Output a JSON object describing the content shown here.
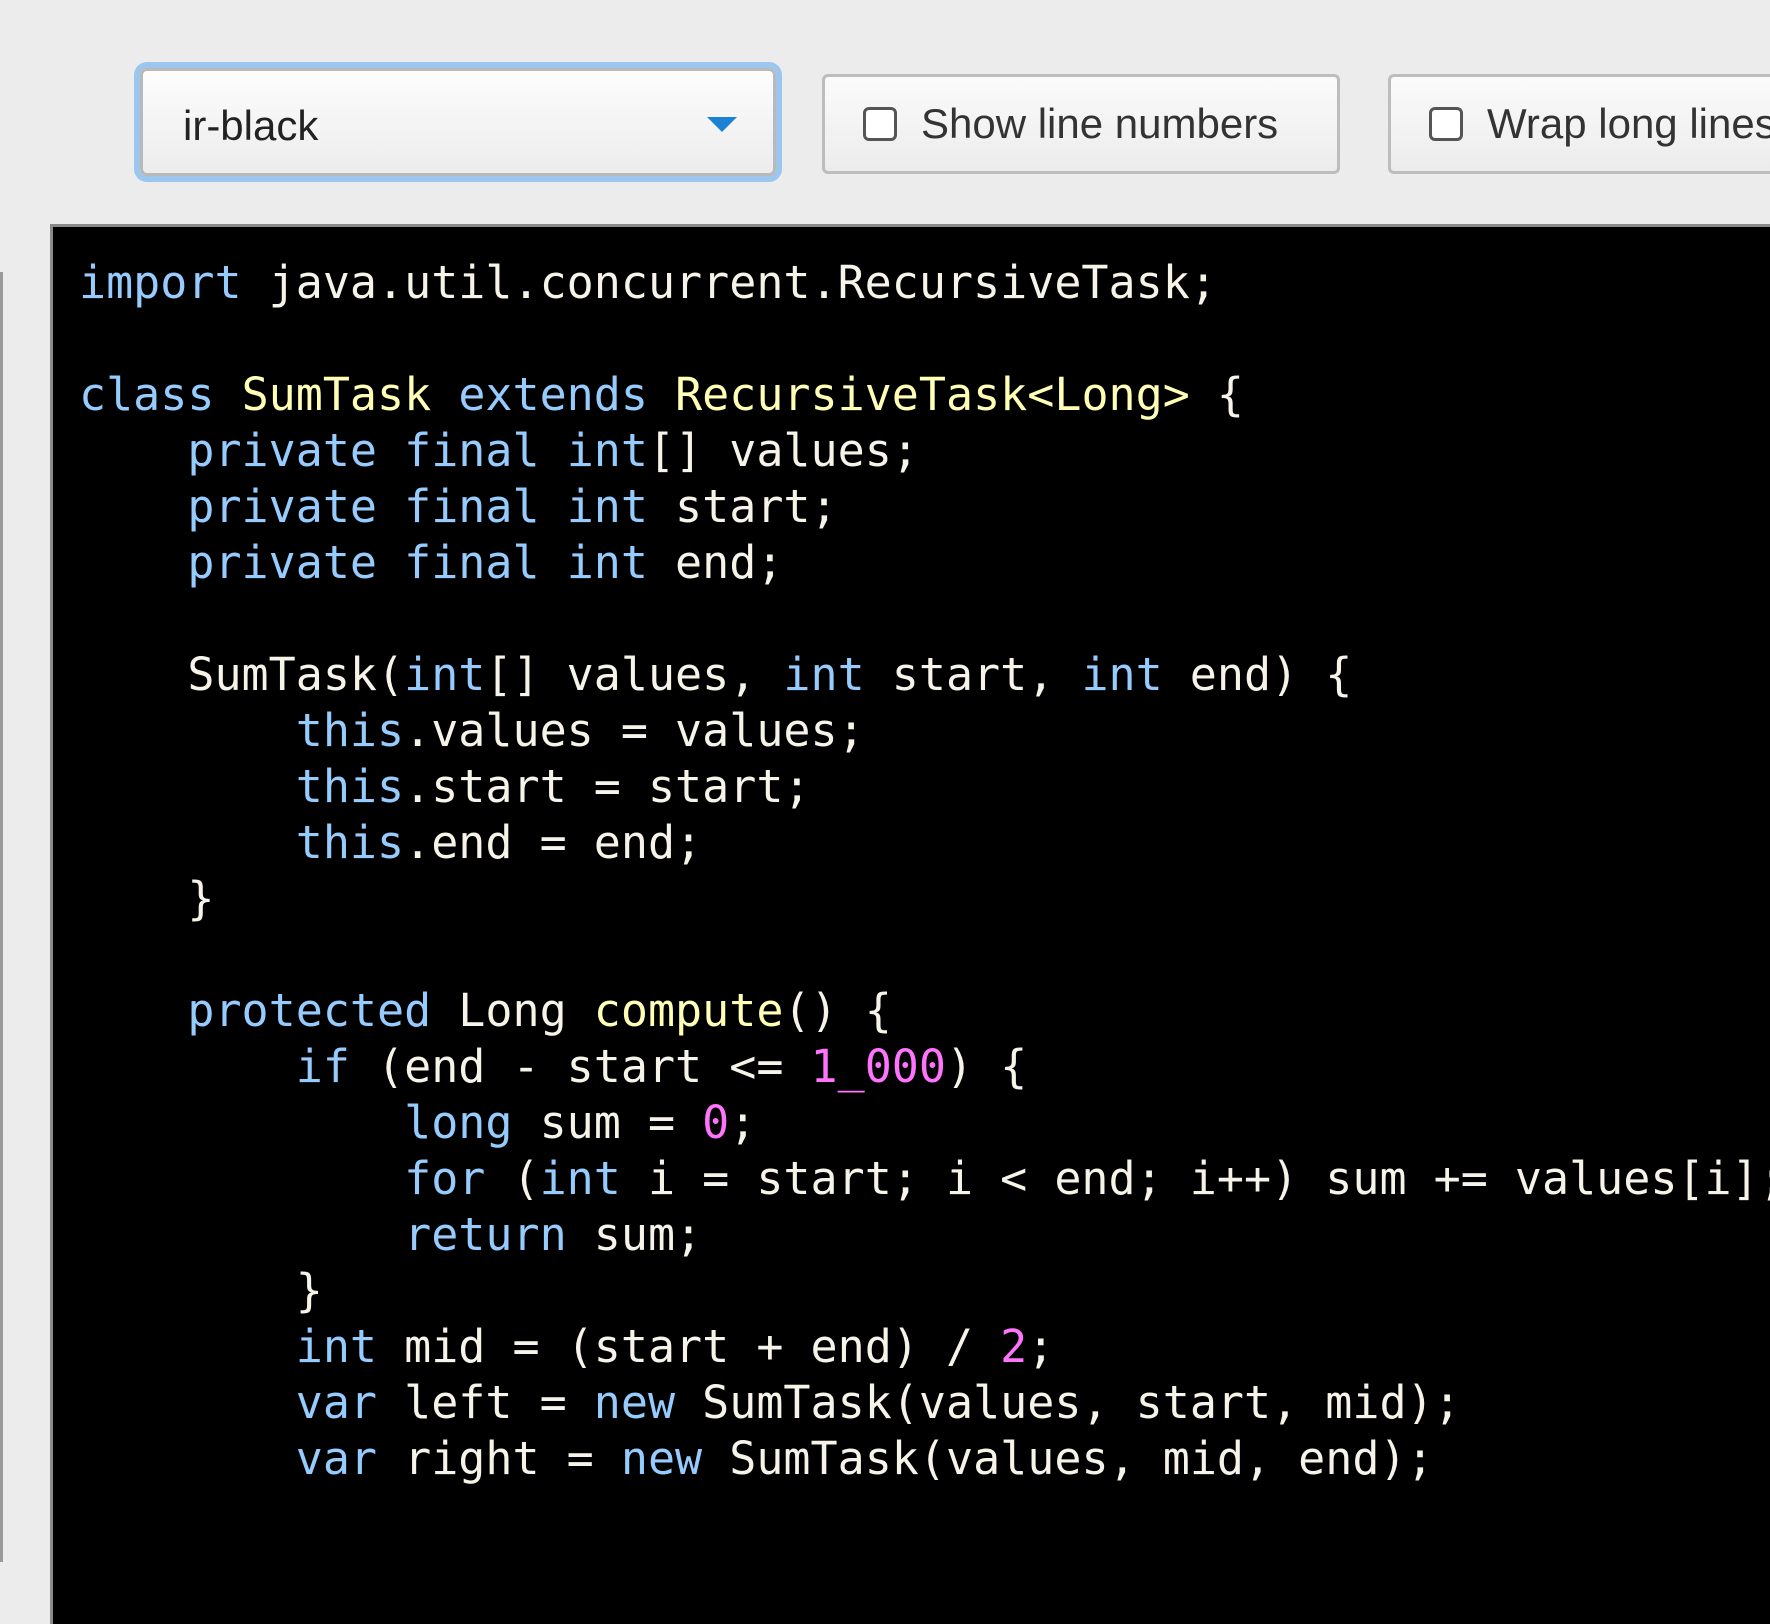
{
  "toolbar": {
    "theme_select": {
      "value": "ir-black"
    },
    "show_line_numbers": {
      "label": "Show line numbers",
      "checked": false
    },
    "wrap_long_lines": {
      "label": "Wrap long lines",
      "checked": false
    }
  },
  "colors": {
    "code_background": "#000000",
    "default_text": "#f6f3e8",
    "keyword": "#96cbfe",
    "type": "#ffffb6",
    "number": "#ff73fd",
    "select_focus_ring": "#9cc6ee",
    "caret": "#1b82d4"
  },
  "icons": {
    "select_caret": "chevron-down-icon",
    "checkbox": "checkbox-unchecked-icon"
  },
  "code": {
    "language": "java",
    "lines": [
      [
        {
          "t": "k",
          "v": "import"
        },
        {
          "t": "p",
          "v": " java.util.concurrent.RecursiveTask;"
        }
      ],
      [],
      [
        {
          "t": "k",
          "v": "class"
        },
        {
          "t": "p",
          "v": " "
        },
        {
          "t": "t",
          "v": "SumTask"
        },
        {
          "t": "p",
          "v": " "
        },
        {
          "t": "k",
          "v": "extends"
        },
        {
          "t": "p",
          "v": " "
        },
        {
          "t": "t",
          "v": "RecursiveTask<Long>"
        },
        {
          "t": "p",
          "v": " {"
        }
      ],
      [
        {
          "t": "p",
          "v": "    "
        },
        {
          "t": "k",
          "v": "private"
        },
        {
          "t": "p",
          "v": " "
        },
        {
          "t": "k",
          "v": "final"
        },
        {
          "t": "p",
          "v": " "
        },
        {
          "t": "k",
          "v": "int"
        },
        {
          "t": "p",
          "v": "[] values;"
        }
      ],
      [
        {
          "t": "p",
          "v": "    "
        },
        {
          "t": "k",
          "v": "private"
        },
        {
          "t": "p",
          "v": " "
        },
        {
          "t": "k",
          "v": "final"
        },
        {
          "t": "p",
          "v": " "
        },
        {
          "t": "k",
          "v": "int"
        },
        {
          "t": "p",
          "v": " start;"
        }
      ],
      [
        {
          "t": "p",
          "v": "    "
        },
        {
          "t": "k",
          "v": "private"
        },
        {
          "t": "p",
          "v": " "
        },
        {
          "t": "k",
          "v": "final"
        },
        {
          "t": "p",
          "v": " "
        },
        {
          "t": "k",
          "v": "int"
        },
        {
          "t": "p",
          "v": " end;"
        }
      ],
      [],
      [
        {
          "t": "p",
          "v": "    SumTask("
        },
        {
          "t": "k",
          "v": "int"
        },
        {
          "t": "p",
          "v": "[] values, "
        },
        {
          "t": "k",
          "v": "int"
        },
        {
          "t": "p",
          "v": " start, "
        },
        {
          "t": "k",
          "v": "int"
        },
        {
          "t": "p",
          "v": " end) {"
        }
      ],
      [
        {
          "t": "p",
          "v": "        "
        },
        {
          "t": "k",
          "v": "this"
        },
        {
          "t": "p",
          "v": ".values = values;"
        }
      ],
      [
        {
          "t": "p",
          "v": "        "
        },
        {
          "t": "k",
          "v": "this"
        },
        {
          "t": "p",
          "v": ".start = start;"
        }
      ],
      [
        {
          "t": "p",
          "v": "        "
        },
        {
          "t": "k",
          "v": "this"
        },
        {
          "t": "p",
          "v": ".end = end;"
        }
      ],
      [
        {
          "t": "p",
          "v": "    }"
        }
      ],
      [],
      [
        {
          "t": "p",
          "v": "    "
        },
        {
          "t": "k",
          "v": "protected"
        },
        {
          "t": "p",
          "v": " Long "
        },
        {
          "t": "t",
          "v": "compute"
        },
        {
          "t": "p",
          "v": "() {"
        }
      ],
      [
        {
          "t": "p",
          "v": "        "
        },
        {
          "t": "k",
          "v": "if"
        },
        {
          "t": "p",
          "v": " (end - start <= "
        },
        {
          "t": "n",
          "v": "1_000"
        },
        {
          "t": "p",
          "v": ") {"
        }
      ],
      [
        {
          "t": "p",
          "v": "            "
        },
        {
          "t": "k",
          "v": "long"
        },
        {
          "t": "p",
          "v": " sum = "
        },
        {
          "t": "n",
          "v": "0"
        },
        {
          "t": "p",
          "v": ";"
        }
      ],
      [
        {
          "t": "p",
          "v": "            "
        },
        {
          "t": "k",
          "v": "for"
        },
        {
          "t": "p",
          "v": " ("
        },
        {
          "t": "k",
          "v": "int"
        },
        {
          "t": "p",
          "v": " i = start; i < end; i++) sum += values[i];"
        }
      ],
      [
        {
          "t": "p",
          "v": "            "
        },
        {
          "t": "k",
          "v": "return"
        },
        {
          "t": "p",
          "v": " sum;"
        }
      ],
      [
        {
          "t": "p",
          "v": "        }"
        }
      ],
      [
        {
          "t": "p",
          "v": "        "
        },
        {
          "t": "k",
          "v": "int"
        },
        {
          "t": "p",
          "v": " mid = (start + end) / "
        },
        {
          "t": "n",
          "v": "2"
        },
        {
          "t": "p",
          "v": ";"
        }
      ],
      [
        {
          "t": "p",
          "v": "        "
        },
        {
          "t": "k",
          "v": "var"
        },
        {
          "t": "p",
          "v": " left = "
        },
        {
          "t": "k",
          "v": "new"
        },
        {
          "t": "p",
          "v": " SumTask(values, start, mid);"
        }
      ],
      [
        {
          "t": "p",
          "v": "        "
        },
        {
          "t": "k",
          "v": "var"
        },
        {
          "t": "p",
          "v": " right = "
        },
        {
          "t": "k",
          "v": "new"
        },
        {
          "t": "p",
          "v": " SumTask(values, mid, end);"
        }
      ]
    ]
  }
}
